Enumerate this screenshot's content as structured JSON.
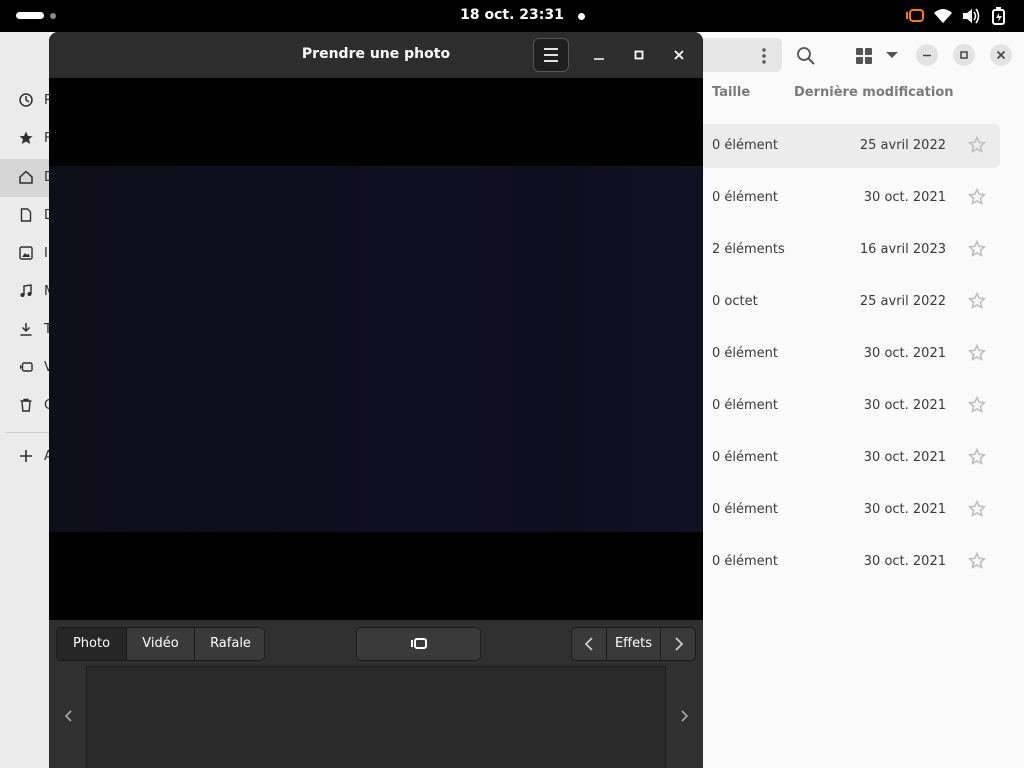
{
  "topbar": {
    "clock": "18 oct.  23:31"
  },
  "files": {
    "sidebar": {
      "items": [
        {
          "icon": "recent-icon",
          "label": "R"
        },
        {
          "icon": "star-icon",
          "label": "F"
        },
        {
          "icon": "home-icon",
          "label": "D"
        },
        {
          "icon": "document-icon",
          "label": "D"
        },
        {
          "icon": "image-icon",
          "label": "I"
        },
        {
          "icon": "music-icon",
          "label": "M"
        },
        {
          "icon": "download-icon",
          "label": "T"
        },
        {
          "icon": "video-icon",
          "label": "V"
        },
        {
          "icon": "trash-icon",
          "label": "C"
        },
        {
          "icon": "plus-icon",
          "label": "A"
        }
      ]
    },
    "columns": {
      "size": "Taille",
      "modified": "Dernière modification"
    },
    "rows": [
      {
        "size": "0 élément",
        "date": "25 avril 2022"
      },
      {
        "size": "0 élément",
        "date": "30 oct. 2021"
      },
      {
        "size": "2 éléments",
        "date": "16 avril 2023"
      },
      {
        "size": "0 octet",
        "date": "25 avril 2022"
      },
      {
        "size": "0 élément",
        "date": "30 oct. 2021"
      },
      {
        "size": "0 élément",
        "date": "30 oct. 2021"
      },
      {
        "size": "0 élément",
        "date": "30 oct. 2021"
      },
      {
        "size": "0 élément",
        "date": "30 oct. 2021"
      },
      {
        "size": "0 élément",
        "date": "30 oct. 2021"
      }
    ]
  },
  "camera": {
    "title": "Prendre une photo",
    "modes": [
      "Photo",
      "Vidéo",
      "Rafale"
    ],
    "active_mode": "Photo",
    "effects_label": "Effets"
  },
  "colors": {
    "camera_bg": "#242424",
    "accent_orange": "#ff7800"
  }
}
